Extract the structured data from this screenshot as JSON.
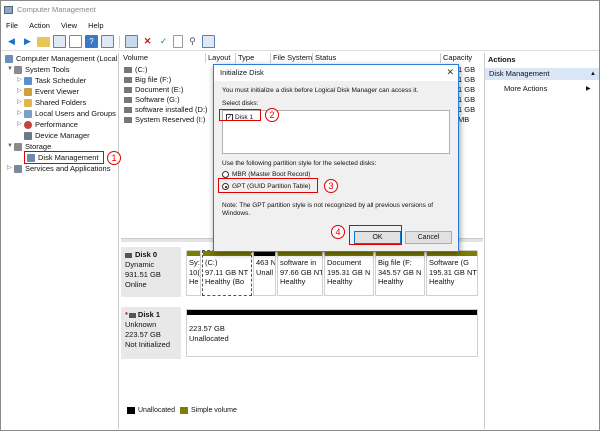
{
  "window": {
    "title": "Computer Management"
  },
  "menu": [
    "File",
    "Action",
    "View",
    "Help"
  ],
  "tree": {
    "root": "Computer Management (Local",
    "system_tools": "System Tools",
    "task_scheduler": "Task Scheduler",
    "event_viewer": "Event Viewer",
    "shared_folders": "Shared Folders",
    "local_users": "Local Users and Groups",
    "performance": "Performance",
    "device_manager": "Device Manager",
    "storage": "Storage",
    "disk_management": "Disk Management",
    "services": "Services and Applications"
  },
  "columns": {
    "volume": "Volume",
    "layout": "Layout",
    "type": "Type",
    "file_system": "File System",
    "status": "Status",
    "capacity": "Capacity"
  },
  "volumes": [
    {
      "name": "(C:)",
      "cap": "1 GB"
    },
    {
      "name": "Big file (F:)",
      "cap": "1 GB"
    },
    {
      "name": "Document (E:)",
      "cap": "1 GB"
    },
    {
      "name": "Software (G:)",
      "cap": "1 GB"
    },
    {
      "name": "software installed (D:)",
      "cap": "1 GB"
    },
    {
      "name": "System Reserved (I:)",
      "cap": "MB"
    }
  ],
  "actions": {
    "header": "Actions",
    "section": "Disk Management",
    "more": "More Actions"
  },
  "disk0": {
    "name": "Disk 0",
    "type": "Dynamic",
    "size": "931.51 GB",
    "status": "Online",
    "parts": [
      {
        "l1": "Sy:",
        "l2": "10(",
        "l3": "He"
      },
      {
        "l1": "(C:)",
        "l2": "97.11 GB NT",
        "l3": "Healthy (Bo"
      },
      {
        "l1": "",
        "l2": "463 N",
        "l3": "Unall"
      },
      {
        "l1": "software in",
        "l2": "97.66 GB NT",
        "l3": "Healthy"
      },
      {
        "l1": "Document",
        "l2": "195.31 GB N",
        "l3": "Healthy"
      },
      {
        "l1": "Big file (F:",
        "l2": "345.57 GB N",
        "l3": "Healthy"
      },
      {
        "l1": "Software (G",
        "l2": "195.31 GB NT",
        "l3": "Healthy"
      }
    ]
  },
  "disk1": {
    "name": "Disk 1",
    "type": "Unknown",
    "size": "223.57 GB",
    "status": "Not Initialized",
    "part_size": "223.57 GB",
    "part_status": "Unallocated"
  },
  "legend": {
    "unallocated": "Unallocated",
    "simple": "Simple volume"
  },
  "dialog": {
    "title": "Initialize Disk",
    "intro": "You must initialize a disk before Logical Disk Manager can access it.",
    "select_label": "Select disks:",
    "disk_item": "Disk 1",
    "style_label": "Use the following partition style for the selected disks:",
    "mbr": "MBR (Master Boot Record)",
    "gpt": "GPT (GUID Partition Table)",
    "note1": "Note: The GPT partition style is not recognized by all previous versions of",
    "note2": "Windows.",
    "ok": "OK",
    "cancel": "Cancel"
  },
  "badges": [
    "1",
    "2",
    "3",
    "4"
  ],
  "colors": {
    "accent": "#0078d7",
    "highlight": "#e00000",
    "partition_bar": "#0000a0",
    "unallocated": "#000000",
    "simple_volume": "#7d7d00"
  }
}
